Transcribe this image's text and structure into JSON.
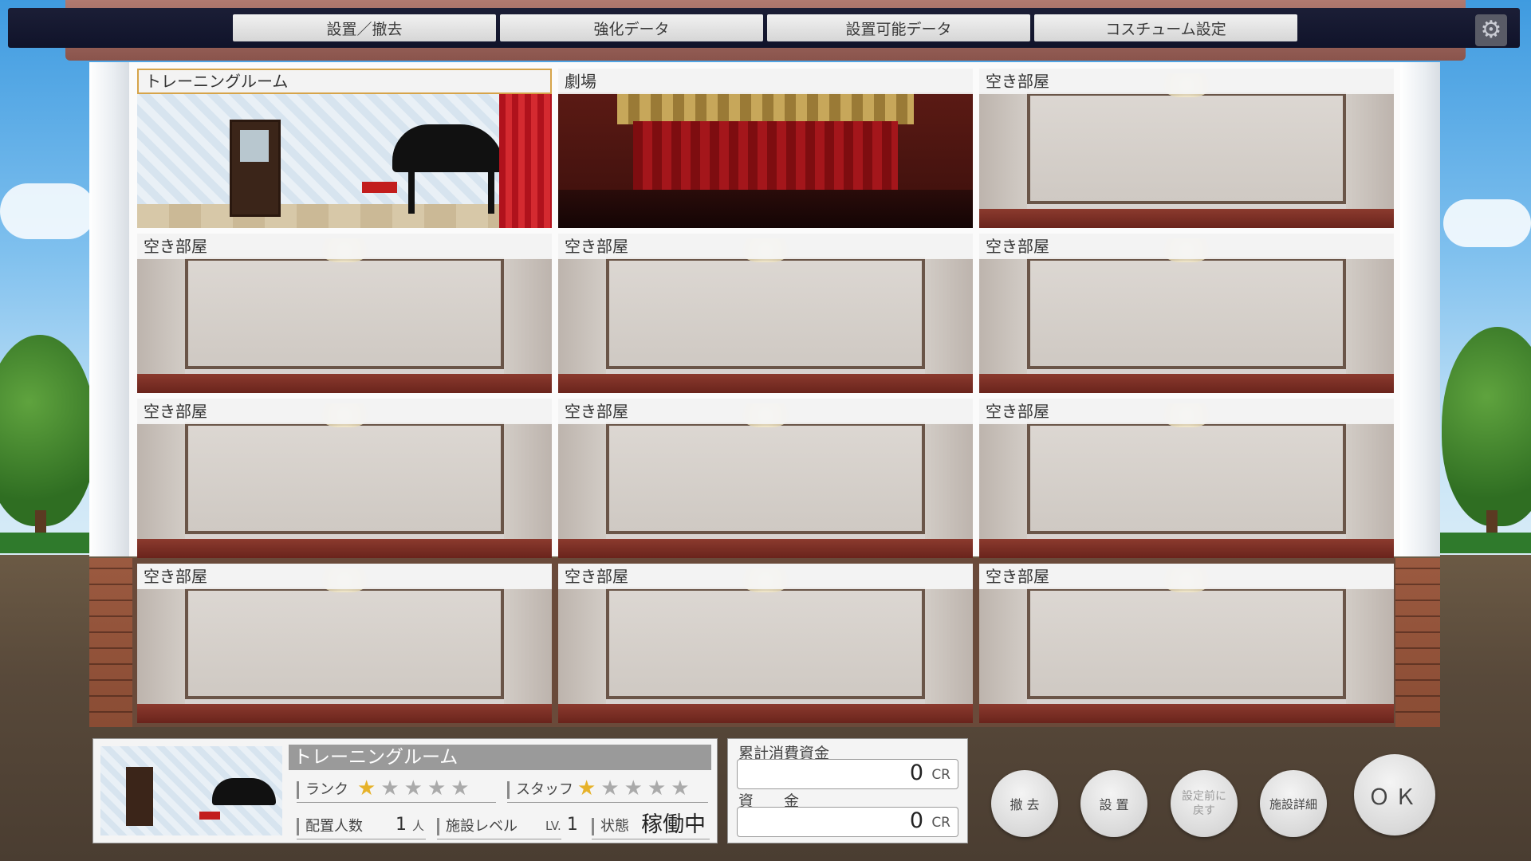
{
  "menu": {
    "tabs": [
      "設置／撤去",
      "強化データ",
      "設置可能データ",
      "コスチューム設定"
    ],
    "settings_icon": "gear-icon"
  },
  "rooms": [
    {
      "label": "トレーニングルーム",
      "type": "training",
      "selected": true
    },
    {
      "label": "劇場",
      "type": "theater",
      "selected": false
    },
    {
      "label": "空き部屋",
      "type": "empty",
      "selected": false
    },
    {
      "label": "空き部屋",
      "type": "empty",
      "selected": false
    },
    {
      "label": "空き部屋",
      "type": "empty",
      "selected": false
    },
    {
      "label": "空き部屋",
      "type": "empty",
      "selected": false
    },
    {
      "label": "空き部屋",
      "type": "empty",
      "selected": false
    },
    {
      "label": "空き部屋",
      "type": "empty",
      "selected": false
    },
    {
      "label": "空き部屋",
      "type": "empty",
      "selected": false
    },
    {
      "label": "空き部屋",
      "type": "empty",
      "selected": false
    },
    {
      "label": "空き部屋",
      "type": "empty",
      "selected": false
    },
    {
      "label": "空き部屋",
      "type": "empty",
      "selected": false
    }
  ],
  "info": {
    "title": "トレーニングルーム",
    "rank_label": "ランク",
    "rank": 1,
    "rank_max": 5,
    "staff_label": "スタッフ",
    "staff": 1,
    "staff_max": 5,
    "members_label": "配置人数",
    "members_value": "1",
    "members_unit": "人",
    "level_label": "施設レベル",
    "level_prefix": "LV.",
    "level_value": "1",
    "status_label": "状態",
    "status_value": "稼働中"
  },
  "funds": {
    "spent_label": "累計消費資金",
    "spent_value": "0",
    "funds_label": "資　　金",
    "funds_value": "0",
    "unit": "CR"
  },
  "actions": {
    "remove": "撤 去",
    "install": "設 置",
    "revert_line1": "設定前に",
    "revert_line2": "戻す",
    "details": "施設詳細",
    "ok": "ＯＫ"
  },
  "colors": {
    "topbar": "#10132a",
    "selected_border": "#d6a44a",
    "star_on": "#e6b22a",
    "star_off": "#aaaaaa"
  }
}
